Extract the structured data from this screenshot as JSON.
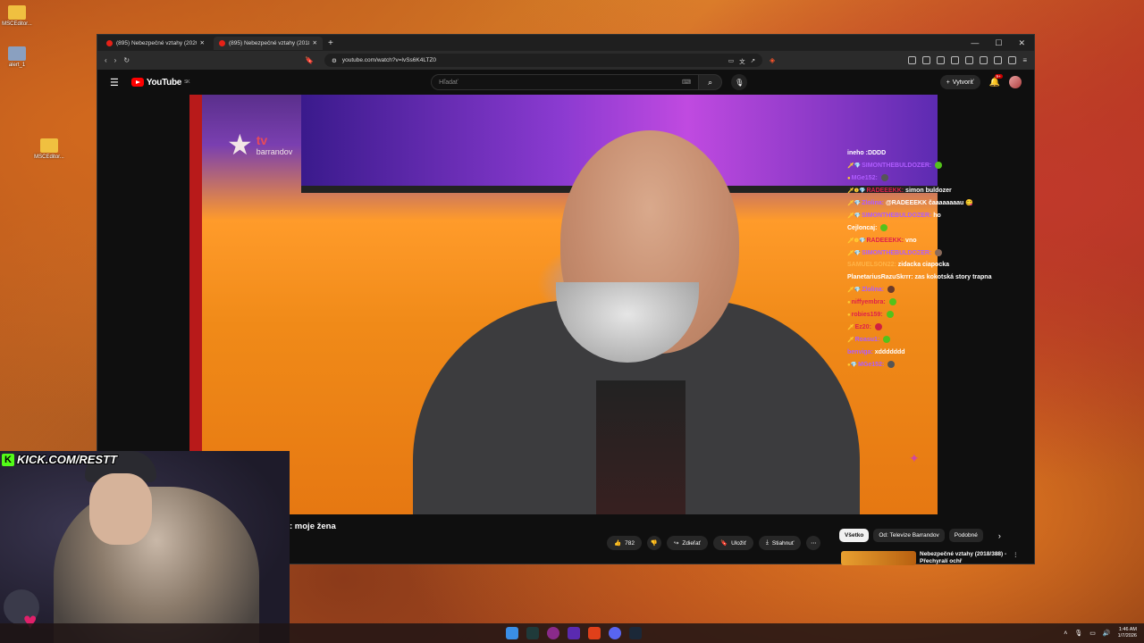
{
  "desktop": {
    "icons": [
      {
        "label": "MSCEditor..."
      },
      {
        "label": "alert_1"
      },
      {
        "label": "MSCEditor..."
      }
    ]
  },
  "browser": {
    "tabs": [
      {
        "title": "(895) Nebezpečné vztahy (2020/136)"
      },
      {
        "title": "(895) Nebezpečné vztahy (2018/"
      }
    ],
    "url": "youtube.com/watch?v=lvSs6K4LTZ0"
  },
  "youtube": {
    "logo": "YouTube",
    "region": "SK",
    "search_placeholder": "Hľadať",
    "create_label": "Vytvoriť",
    "notifications_count": "9+"
  },
  "video": {
    "channel_watermark_top": "tv",
    "channel_watermark_bottom": "barrandov",
    "title": ": moje žena"
  },
  "actions": {
    "likes": "782",
    "share": "Zdieľať",
    "save": "Uložiť",
    "download": "Stiahnuť"
  },
  "chips": [
    "Všetko",
    "Od: Televize Barrandov",
    "Podobné"
  ],
  "recommendation": {
    "title": "Nebezpečné vztahy (2018/388) - Přechyralí ochř"
  },
  "chat": [
    {
      "user": "",
      "text": "ineho :DDDD",
      "color": "#ffffff",
      "badges": ""
    },
    {
      "user": "SIMONTHEBULDOZER:",
      "text": "",
      "color": "#b05cff",
      "badges": "🗡💎",
      "emote": "#53c21b"
    },
    {
      "user": "MGe152:",
      "text": "",
      "color": "#b05cff",
      "badges": "●",
      "emote": "#555555"
    },
    {
      "user": "RADEEEKK:",
      "text": "simon buldozer",
      "color": "#e0204a",
      "badges": "🗡❶💎"
    },
    {
      "user": "Zlolina:",
      "text": "@RADEEEKK čaaaaaaaau 😋",
      "color": "#b05cff",
      "badges": "🗡💎"
    },
    {
      "user": "SIMONTHEBULDOZER:",
      "text": "ho",
      "color": "#b05cff",
      "badges": "🗡💎"
    },
    {
      "user": "Cejloncaj:",
      "text": "",
      "color": "#ffffff",
      "badges": "",
      "emote": "#53c21b"
    },
    {
      "user": "RADEEEKK:",
      "text": "vno",
      "color": "#e0204a",
      "badges": "🗡❶💎"
    },
    {
      "user": "SIMONTHEBULDOZER:",
      "text": "",
      "color": "#b05cff",
      "badges": "🗡💎",
      "emote": "#8a6a5a"
    },
    {
      "user": "SAMUELSON22:",
      "text": "zidacka ciapocka",
      "color": "#ffb347",
      "badges": ""
    },
    {
      "user": "PlanetariusRazuSkrrr:",
      "text": "zas kokotská story trapna",
      "color": "#ffffff",
      "badges": ""
    },
    {
      "user": "Zlolina:",
      "text": "",
      "color": "#b05cff",
      "badges": "🗡💎",
      "emote": "#6a3a2a"
    },
    {
      "user": "niffyembra:",
      "text": "",
      "color": "#e0204a",
      "badges": "●",
      "emote": "#53c21b"
    },
    {
      "user": "robies159:",
      "text": "",
      "color": "#e0204a",
      "badges": "●",
      "emote": "#53c21b"
    },
    {
      "user": "Ez20:",
      "text": "",
      "color": "#e0204a",
      "badges": "🗡",
      "emote": "#d02040"
    },
    {
      "user": "Roasu1:",
      "text": "",
      "color": "#b05cff",
      "badges": "🗡",
      "emote": "#53c21b"
    },
    {
      "user": "benviga:",
      "text": "xddddddd",
      "color": "#b05cff",
      "badges": ""
    },
    {
      "user": "MGe152:",
      "text": "",
      "color": "#b05cff",
      "badges": "●💎",
      "emote": "#555555"
    }
  ],
  "overlay": {
    "kick_url": "KICK.COM/RESTT"
  },
  "taskbar": {
    "time": "1:46 AM",
    "date": "1/7/2026"
  },
  "colors": {
    "youtube_red": "#ff0000",
    "kick_green": "#53fc18",
    "page_bg": "#0f0f0f"
  }
}
